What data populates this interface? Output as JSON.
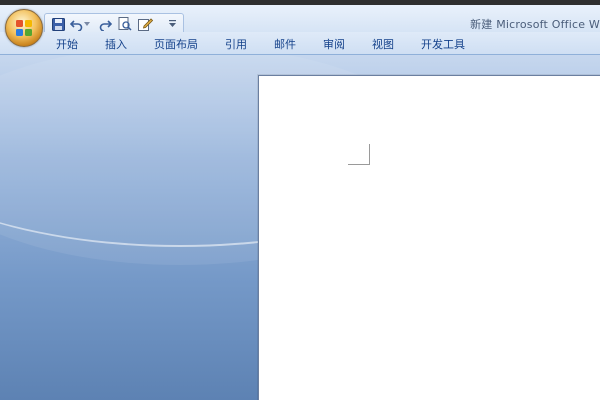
{
  "window": {
    "title": "新建 Microsoft Office W"
  },
  "office_button": {
    "icon": "office-logo-icon"
  },
  "quick_access": {
    "items": [
      {
        "name": "save-icon"
      },
      {
        "name": "undo-icon"
      },
      {
        "name": "undo-dropdown-icon"
      },
      {
        "name": "redo-icon"
      },
      {
        "name": "print-preview-icon"
      },
      {
        "name": "edit-icon"
      },
      {
        "name": "customize-dropdown-icon"
      }
    ]
  },
  "ribbon": {
    "tabs": [
      {
        "label": "开始"
      },
      {
        "label": "插入"
      },
      {
        "label": "页面布局"
      },
      {
        "label": "引用"
      },
      {
        "label": "邮件"
      },
      {
        "label": "审阅"
      },
      {
        "label": "视图"
      },
      {
        "label": "开发工具"
      }
    ]
  },
  "colors": {
    "tab_text": "#15428b",
    "workspace_bg": "#5f84b4",
    "page": "#ffffff"
  }
}
